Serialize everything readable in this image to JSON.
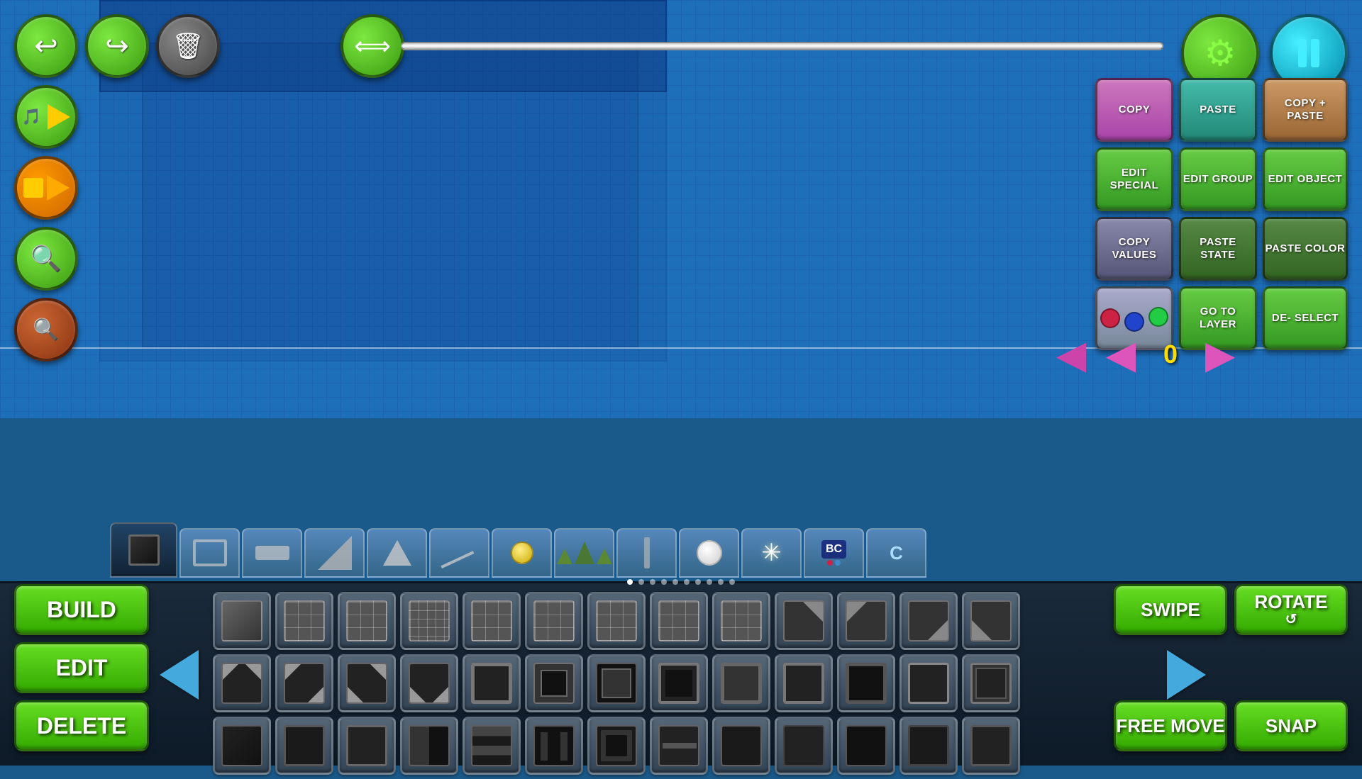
{
  "canvas": {
    "background_color": "#1e6fba"
  },
  "top_toolbar": {
    "undo_label": "↩",
    "redo_label": "↪",
    "delete_label": "🗑",
    "slider_value": 0,
    "settings_label": "⚙",
    "pause_label": "⏸"
  },
  "left_buttons": {
    "music_label": "🎵",
    "play_label": "▶",
    "stop_label": "■",
    "zoom_in_label": "+🔍",
    "zoom_out_label": "-🔍"
  },
  "right_panel": {
    "copy_label": "COPY",
    "paste_label": "PASTE",
    "copy_paste_label": "COPY + PASTE",
    "edit_special_label": "EDIT SPECIAL",
    "edit_group_label": "EDIT GROUP",
    "edit_object_label": "EDIT OBJECT",
    "copy_values_label": "COPY VALUES",
    "paste_state_label": "PASTE STATE",
    "paste_color_label": "PASTE COLOR",
    "goto_layer_label": "GO TO LAYER",
    "deselect_label": "DE- SELECT"
  },
  "layer_nav": {
    "left_arrow": "◀",
    "right_arrow": "▶",
    "value": "0"
  },
  "object_tabs": [
    {
      "icon": "square",
      "active": true
    },
    {
      "icon": "rect"
    },
    {
      "icon": "thin-rect"
    },
    {
      "icon": "diagonal"
    },
    {
      "icon": "triangle"
    },
    {
      "icon": "slope"
    },
    {
      "icon": "circle-yellow"
    },
    {
      "icon": "mountains"
    },
    {
      "icon": "pillar"
    },
    {
      "icon": "white-circle"
    },
    {
      "icon": "burst"
    },
    {
      "icon": "bc"
    },
    {
      "icon": "c"
    }
  ],
  "mode_buttons": {
    "build_label": "BUILD",
    "edit_label": "EDIT",
    "delete_label": "DELETE"
  },
  "action_buttons": {
    "swipe_label": "SWIPE",
    "rotate_label": "ROTATE",
    "free_move_label": "FREE MOVE",
    "snap_label": "SNAP"
  },
  "pagination": {
    "dots": [
      0,
      1,
      2,
      3,
      4,
      5,
      6,
      7,
      8,
      9
    ],
    "active": 0
  },
  "object_grid": {
    "rows": 3,
    "cols": 13
  }
}
